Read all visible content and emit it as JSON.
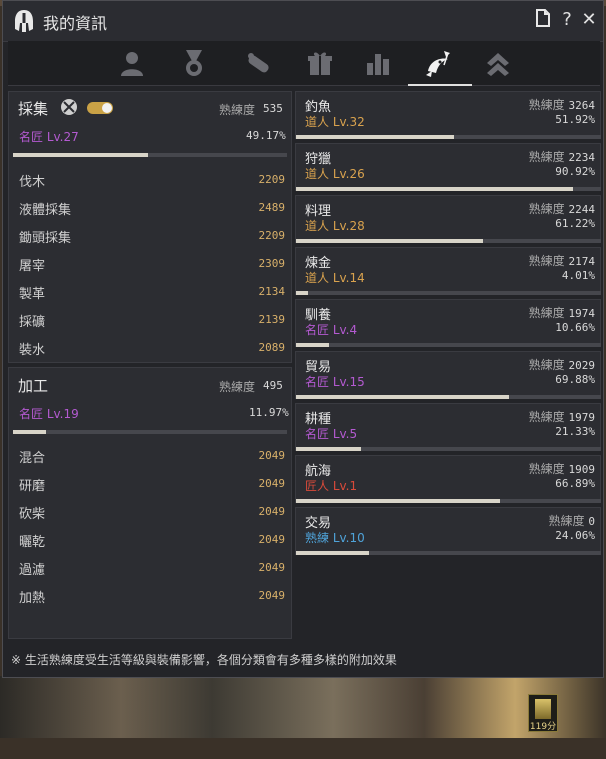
{
  "window": {
    "title": "我的資訊"
  },
  "titlebar_icons": [
    "document-icon",
    "help-icon",
    "close-icon"
  ],
  "tabs": [
    {
      "name": "profile-icon",
      "active": false
    },
    {
      "name": "medal-icon",
      "active": false
    },
    {
      "name": "scroll-icon",
      "active": false
    },
    {
      "name": "gift-icon",
      "active": false
    },
    {
      "name": "bar-chart-icon",
      "active": false
    },
    {
      "name": "fishing-icon",
      "active": true
    },
    {
      "name": "rank-chevron-icon",
      "active": false
    }
  ],
  "gathering": {
    "title": "採集",
    "proficiency_label": "熟練度",
    "proficiency": "535",
    "level": "名匠 Lv.27",
    "percent": "49.17%",
    "progress": 0.4917,
    "toggle_on": true,
    "items": [
      {
        "label": "伐木",
        "value": "2209"
      },
      {
        "label": "液體採集",
        "value": "2489"
      },
      {
        "label": "鋤頭採集",
        "value": "2209"
      },
      {
        "label": "屠宰",
        "value": "2309"
      },
      {
        "label": "製革",
        "value": "2134"
      },
      {
        "label": "採礦",
        "value": "2139"
      },
      {
        "label": "裝水",
        "value": "2089"
      }
    ]
  },
  "processing": {
    "title": "加工",
    "proficiency_label": "熟練度",
    "proficiency": "495",
    "level": "名匠 Lv.19",
    "percent": "11.97%",
    "progress": 0.1197,
    "items": [
      {
        "label": "混合",
        "value": "2049"
      },
      {
        "label": "研磨",
        "value": "2049"
      },
      {
        "label": "砍柴",
        "value": "2049"
      },
      {
        "label": "曬乾",
        "value": "2049"
      },
      {
        "label": "過濾",
        "value": "2049"
      },
      {
        "label": "加熱",
        "value": "2049"
      }
    ]
  },
  "skills": [
    {
      "name": "釣魚",
      "proficiency_label": "熟練度",
      "proficiency": "3264",
      "level": "道人 Lv.32",
      "tier": "gold",
      "percent": "51.92%",
      "progress": 0.5192
    },
    {
      "name": "狩獵",
      "proficiency_label": "熟練度",
      "proficiency": "2234",
      "level": "道人 Lv.26",
      "tier": "gold",
      "percent": "90.92%",
      "progress": 0.9092
    },
    {
      "name": "料理",
      "proficiency_label": "熟練度",
      "proficiency": "2244",
      "level": "道人 Lv.28",
      "tier": "gold",
      "percent": "61.22%",
      "progress": 0.6122
    },
    {
      "name": "煉金",
      "proficiency_label": "熟練度",
      "proficiency": "2174",
      "level": "道人 Lv.14",
      "tier": "gold",
      "percent": "4.01%",
      "progress": 0.0401
    },
    {
      "name": "馴養",
      "proficiency_label": "熟練度",
      "proficiency": "1974",
      "level": "名匠 Lv.4",
      "tier": "purple",
      "percent": "10.66%",
      "progress": 0.1066
    },
    {
      "name": "貿易",
      "proficiency_label": "熟練度",
      "proficiency": "2029",
      "level": "名匠 Lv.15",
      "tier": "purple",
      "percent": "69.88%",
      "progress": 0.6988
    },
    {
      "name": "耕種",
      "proficiency_label": "熟練度",
      "proficiency": "1979",
      "level": "名匠 Lv.5",
      "tier": "purple",
      "percent": "21.33%",
      "progress": 0.2133
    },
    {
      "name": "航海",
      "proficiency_label": "熟練度",
      "proficiency": "1909",
      "level": "匠人 Lv.1",
      "tier": "red",
      "percent": "66.89%",
      "progress": 0.6689
    },
    {
      "name": "交易",
      "proficiency_label": "熟練度",
      "proficiency": "0",
      "level": "熟練 Lv.10",
      "tier": "blue",
      "percent": "24.06%",
      "progress": 0.2406
    }
  ],
  "footer": "※ 生活熟練度受生活等級與裝備影響，各個分類會有多種多樣的附加效果",
  "taskbar": {
    "label": "119分"
  },
  "colors": {
    "gold": "#d9a24e",
    "purple": "#b45ad1",
    "red": "#d94a3a",
    "blue": "#4fa3d9",
    "bar": "#d8d4c8"
  }
}
